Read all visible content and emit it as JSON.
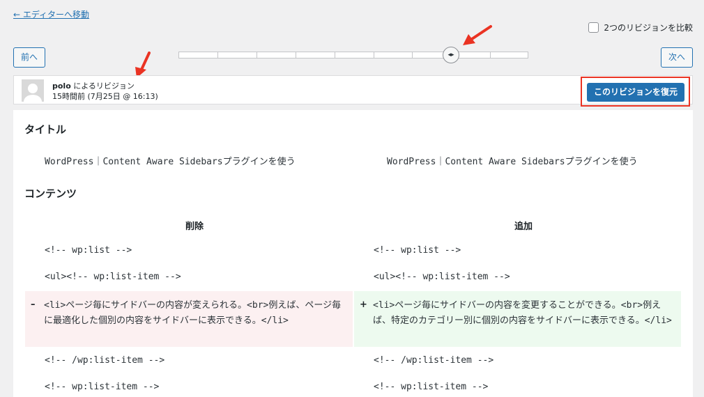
{
  "header": {
    "back_link": "← エディターへ移動",
    "compare_label": "2つのリビジョンを比較"
  },
  "nav": {
    "prev": "前へ",
    "next": "次へ"
  },
  "slider": {
    "position_index": 7,
    "tick_count": 9
  },
  "revision": {
    "author": "polo",
    "author_suffix": " によるリビジョン",
    "time": "15時間前 (7月25日 @ 16:13)",
    "restore_button": "このリビジョンを復元"
  },
  "diff": {
    "title_heading": "タイトル",
    "title_left": "WordPress｜Content Aware Sidebarsプラグインを使う",
    "title_right": "WordPress｜Content Aware Sidebarsプラグインを使う",
    "content_heading": "コンテンツ",
    "col_removed": "削除",
    "col_added": "追加",
    "rows": [
      {
        "left": "<!-- wp:list -->",
        "right": "<!-- wp:list -->"
      },
      {
        "left": "<ul><!-- wp:list-item -->",
        "right": "<ul><!-- wp:list-item -->"
      },
      {
        "left": "<!-- /wp:list-item -->",
        "right": "<!-- /wp:list-item -->"
      },
      {
        "left": "<!-- wp:list-item -->",
        "right": "<!-- wp:list-item -->"
      }
    ],
    "removed_sign": "–",
    "added_sign": "+",
    "removed_text": "<li>ページ毎にサイドバーの内容が変えられる。<br>例えば、ページ毎に最適化した個別の内容をサイドバーに表示できる。</li>",
    "added_text": "<li>ページ毎にサイドバーの内容を変更することができる。<br>例えば、特定のカテゴリー別に個別の内容をサイドバーに表示できる。</li>"
  },
  "colors": {
    "accent": "#2271b1",
    "highlight": "#ea3323",
    "removed_bg": "#fcf0f1",
    "added_bg": "#edfaef"
  }
}
